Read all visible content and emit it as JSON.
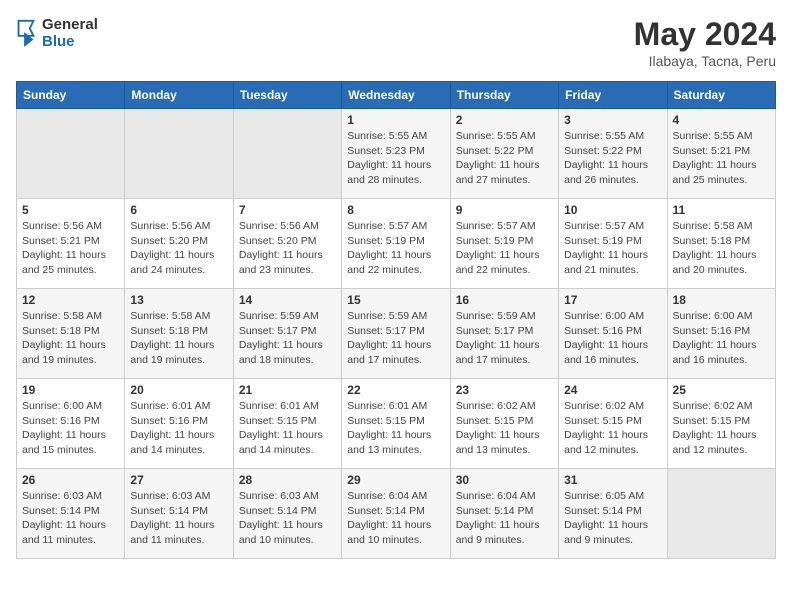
{
  "header": {
    "logo_general": "General",
    "logo_blue": "Blue",
    "main_title": "May 2024",
    "subtitle": "Ilabaya, Tacna, Peru"
  },
  "days_of_week": [
    "Sunday",
    "Monday",
    "Tuesday",
    "Wednesday",
    "Thursday",
    "Friday",
    "Saturday"
  ],
  "weeks": [
    [
      {
        "day": "",
        "info": ""
      },
      {
        "day": "",
        "info": ""
      },
      {
        "day": "",
        "info": ""
      },
      {
        "day": "1",
        "info": "Sunrise: 5:55 AM\nSunset: 5:23 PM\nDaylight: 11 hours\nand 28 minutes."
      },
      {
        "day": "2",
        "info": "Sunrise: 5:55 AM\nSunset: 5:22 PM\nDaylight: 11 hours\nand 27 minutes."
      },
      {
        "day": "3",
        "info": "Sunrise: 5:55 AM\nSunset: 5:22 PM\nDaylight: 11 hours\nand 26 minutes."
      },
      {
        "day": "4",
        "info": "Sunrise: 5:55 AM\nSunset: 5:21 PM\nDaylight: 11 hours\nand 25 minutes."
      }
    ],
    [
      {
        "day": "5",
        "info": "Sunrise: 5:56 AM\nSunset: 5:21 PM\nDaylight: 11 hours\nand 25 minutes."
      },
      {
        "day": "6",
        "info": "Sunrise: 5:56 AM\nSunset: 5:20 PM\nDaylight: 11 hours\nand 24 minutes."
      },
      {
        "day": "7",
        "info": "Sunrise: 5:56 AM\nSunset: 5:20 PM\nDaylight: 11 hours\nand 23 minutes."
      },
      {
        "day": "8",
        "info": "Sunrise: 5:57 AM\nSunset: 5:19 PM\nDaylight: 11 hours\nand 22 minutes."
      },
      {
        "day": "9",
        "info": "Sunrise: 5:57 AM\nSunset: 5:19 PM\nDaylight: 11 hours\nand 22 minutes."
      },
      {
        "day": "10",
        "info": "Sunrise: 5:57 AM\nSunset: 5:19 PM\nDaylight: 11 hours\nand 21 minutes."
      },
      {
        "day": "11",
        "info": "Sunrise: 5:58 AM\nSunset: 5:18 PM\nDaylight: 11 hours\nand 20 minutes."
      }
    ],
    [
      {
        "day": "12",
        "info": "Sunrise: 5:58 AM\nSunset: 5:18 PM\nDaylight: 11 hours\nand 19 minutes."
      },
      {
        "day": "13",
        "info": "Sunrise: 5:58 AM\nSunset: 5:18 PM\nDaylight: 11 hours\nand 19 minutes."
      },
      {
        "day": "14",
        "info": "Sunrise: 5:59 AM\nSunset: 5:17 PM\nDaylight: 11 hours\nand 18 minutes."
      },
      {
        "day": "15",
        "info": "Sunrise: 5:59 AM\nSunset: 5:17 PM\nDaylight: 11 hours\nand 17 minutes."
      },
      {
        "day": "16",
        "info": "Sunrise: 5:59 AM\nSunset: 5:17 PM\nDaylight: 11 hours\nand 17 minutes."
      },
      {
        "day": "17",
        "info": "Sunrise: 6:00 AM\nSunset: 5:16 PM\nDaylight: 11 hours\nand 16 minutes."
      },
      {
        "day": "18",
        "info": "Sunrise: 6:00 AM\nSunset: 5:16 PM\nDaylight: 11 hours\nand 16 minutes."
      }
    ],
    [
      {
        "day": "19",
        "info": "Sunrise: 6:00 AM\nSunset: 5:16 PM\nDaylight: 11 hours\nand 15 minutes."
      },
      {
        "day": "20",
        "info": "Sunrise: 6:01 AM\nSunset: 5:16 PM\nDaylight: 11 hours\nand 14 minutes."
      },
      {
        "day": "21",
        "info": "Sunrise: 6:01 AM\nSunset: 5:15 PM\nDaylight: 11 hours\nand 14 minutes."
      },
      {
        "day": "22",
        "info": "Sunrise: 6:01 AM\nSunset: 5:15 PM\nDaylight: 11 hours\nand 13 minutes."
      },
      {
        "day": "23",
        "info": "Sunrise: 6:02 AM\nSunset: 5:15 PM\nDaylight: 11 hours\nand 13 minutes."
      },
      {
        "day": "24",
        "info": "Sunrise: 6:02 AM\nSunset: 5:15 PM\nDaylight: 11 hours\nand 12 minutes."
      },
      {
        "day": "25",
        "info": "Sunrise: 6:02 AM\nSunset: 5:15 PM\nDaylight: 11 hours\nand 12 minutes."
      }
    ],
    [
      {
        "day": "26",
        "info": "Sunrise: 6:03 AM\nSunset: 5:14 PM\nDaylight: 11 hours\nand 11 minutes."
      },
      {
        "day": "27",
        "info": "Sunrise: 6:03 AM\nSunset: 5:14 PM\nDaylight: 11 hours\nand 11 minutes."
      },
      {
        "day": "28",
        "info": "Sunrise: 6:03 AM\nSunset: 5:14 PM\nDaylight: 11 hours\nand 10 minutes."
      },
      {
        "day": "29",
        "info": "Sunrise: 6:04 AM\nSunset: 5:14 PM\nDaylight: 11 hours\nand 10 minutes."
      },
      {
        "day": "30",
        "info": "Sunrise: 6:04 AM\nSunset: 5:14 PM\nDaylight: 11 hours\nand 9 minutes."
      },
      {
        "day": "31",
        "info": "Sunrise: 6:05 AM\nSunset: 5:14 PM\nDaylight: 11 hours\nand 9 minutes."
      },
      {
        "day": "",
        "info": ""
      }
    ]
  ]
}
